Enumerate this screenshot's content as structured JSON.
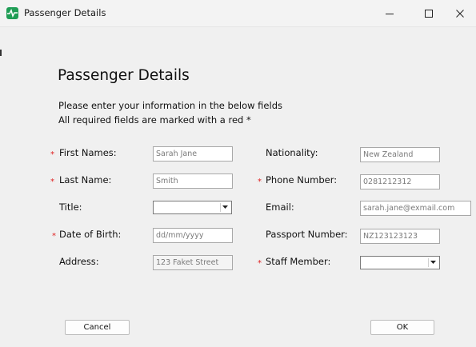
{
  "window": {
    "title": "Passenger Details",
    "icon": "app-heartbeat-icon",
    "controls": [
      "minimize-icon",
      "maximize-icon",
      "close-icon"
    ]
  },
  "form": {
    "heading": "Passenger Details",
    "instructions": [
      "Please enter your information in the below fields",
      "All required fields are marked with a red *"
    ],
    "required_marker": "*",
    "required_color": "#e02020",
    "left": {
      "first_names": {
        "label": "First Names:",
        "value": "Sarah Jane",
        "required": true
      },
      "last_name": {
        "label": "Last Name:",
        "value": "Smith",
        "required": true
      },
      "title": {
        "label": "Title:",
        "value": "",
        "required": false
      },
      "dob": {
        "label": "Date of Birth:",
        "placeholder": "dd/mm/yyyy",
        "required": true
      },
      "address": {
        "label": "Address:",
        "value": "123 Faket Street",
        "required": false
      }
    },
    "right": {
      "nationality": {
        "label": "Nationality:",
        "value": "New Zealand",
        "required": false
      },
      "phone": {
        "label": "Phone Number:",
        "value": "0281212312",
        "required": true
      },
      "email": {
        "label": "Email:",
        "value": "sarah.jane@exmail.com",
        "required": false
      },
      "passport": {
        "label": "Passport Number:",
        "value": "NZ123123123",
        "required": false
      },
      "staff_member": {
        "label": "Staff Member:",
        "value": "",
        "required": true
      }
    }
  },
  "buttons": {
    "cancel": "Cancel",
    "ok": "OK"
  }
}
